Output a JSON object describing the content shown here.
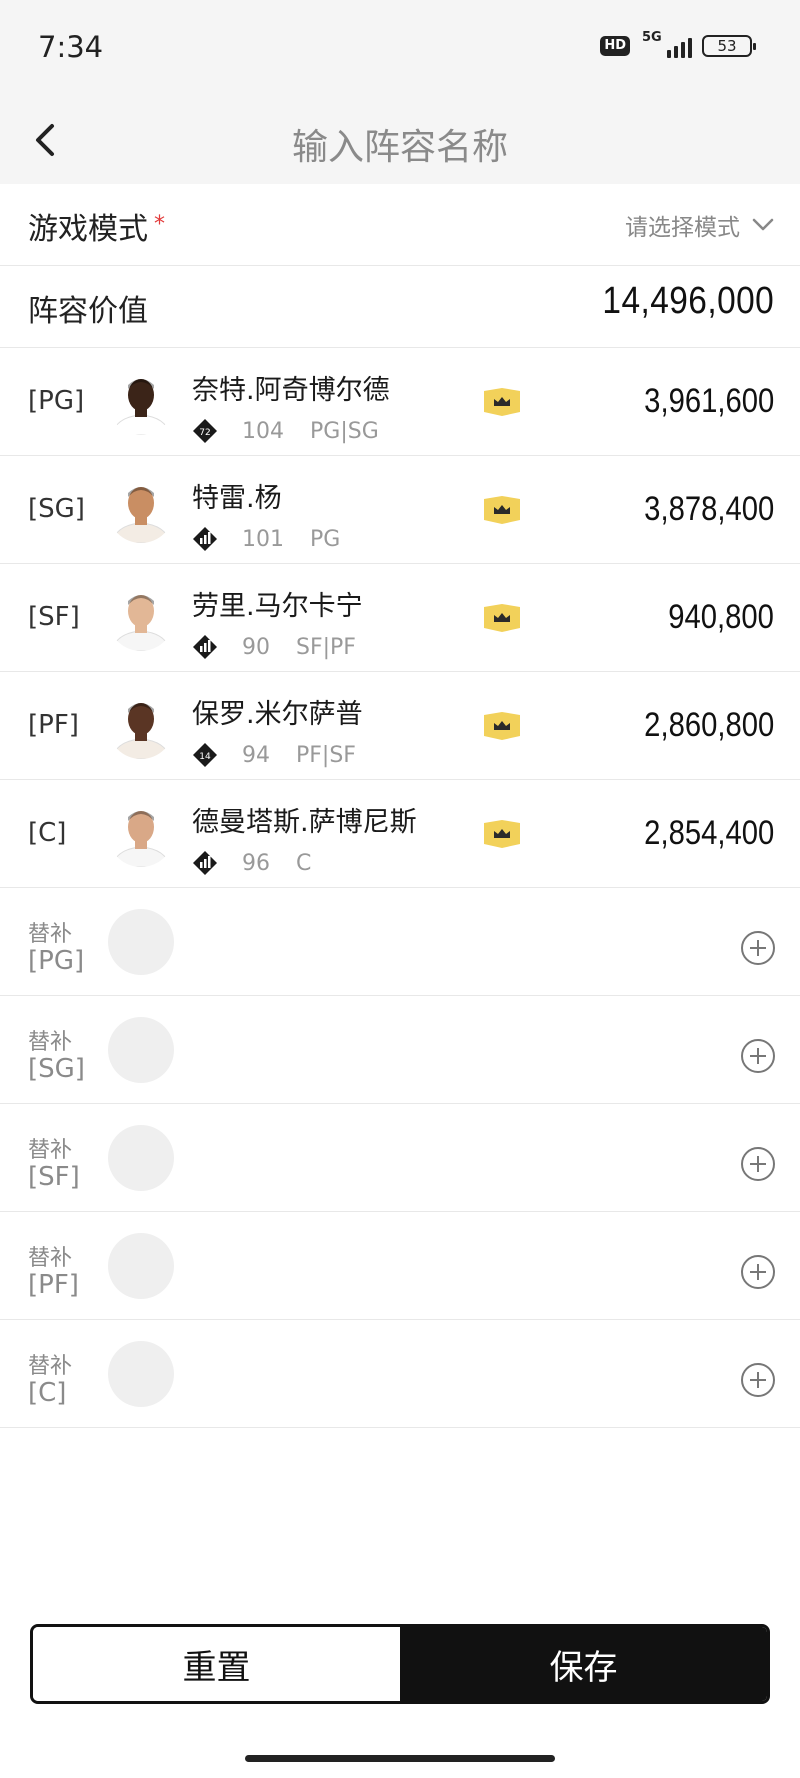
{
  "status": {
    "time": "7:34",
    "hd": "HD",
    "network": "5G",
    "battery": "53"
  },
  "nav": {
    "title": "输入阵容名称"
  },
  "mode": {
    "label": "游戏模式",
    "required_mark": "*",
    "placeholder": "请选择模式"
  },
  "lineup_value": {
    "label": "阵容价值",
    "amount": "14,496,000"
  },
  "starters": [
    {
      "slot": "[PG]",
      "name": "奈特.阿奇博尔德",
      "badge": "72",
      "ovr": "104",
      "positions": "PG|SG",
      "price": "3,961,600",
      "skin": "#3b2418",
      "jersey": "#ffffff"
    },
    {
      "slot": "[SG]",
      "name": "特雷.杨",
      "badge": "",
      "ovr": "101",
      "positions": "PG",
      "price": "3,878,400",
      "skin": "#c98e63",
      "jersey": "#f3ece4"
    },
    {
      "slot": "[SF]",
      "name": "劳里.马尔卡宁",
      "badge": "",
      "ovr": "90",
      "positions": "SF|PF",
      "price": "940,800",
      "skin": "#e2b796",
      "jersey": "#f6f6f6"
    },
    {
      "slot": "[PF]",
      "name": "保罗.米尔萨普",
      "badge": "14",
      "ovr": "94",
      "positions": "PF|SF",
      "price": "2,860,800",
      "skin": "#5a3524",
      "jersey": "#f3ece4"
    },
    {
      "slot": "[C]",
      "name": "德曼塔斯.萨博尼斯",
      "badge": "",
      "ovr": "96",
      "positions": "C",
      "price": "2,854,400",
      "skin": "#d9a887",
      "jersey": "#f6f6f6"
    }
  ],
  "bench": [
    {
      "label": "替补",
      "slot": "[PG]"
    },
    {
      "label": "替补",
      "slot": "[SG]"
    },
    {
      "label": "替补",
      "slot": "[SF]"
    },
    {
      "label": "替补",
      "slot": "[PF]"
    },
    {
      "label": "替补",
      "slot": "[C]"
    }
  ],
  "actions": {
    "reset": "重置",
    "save": "保存"
  },
  "colors": {
    "crown": "#f2d15a",
    "accent_dark": "#111111",
    "required": "#e23b3b"
  },
  "icons": {
    "back": "chevron-left-icon",
    "dropdown": "chevron-down-icon",
    "add": "plus-circle-icon",
    "crown": "crown-icon",
    "tier": "diamond-badge-icon"
  }
}
